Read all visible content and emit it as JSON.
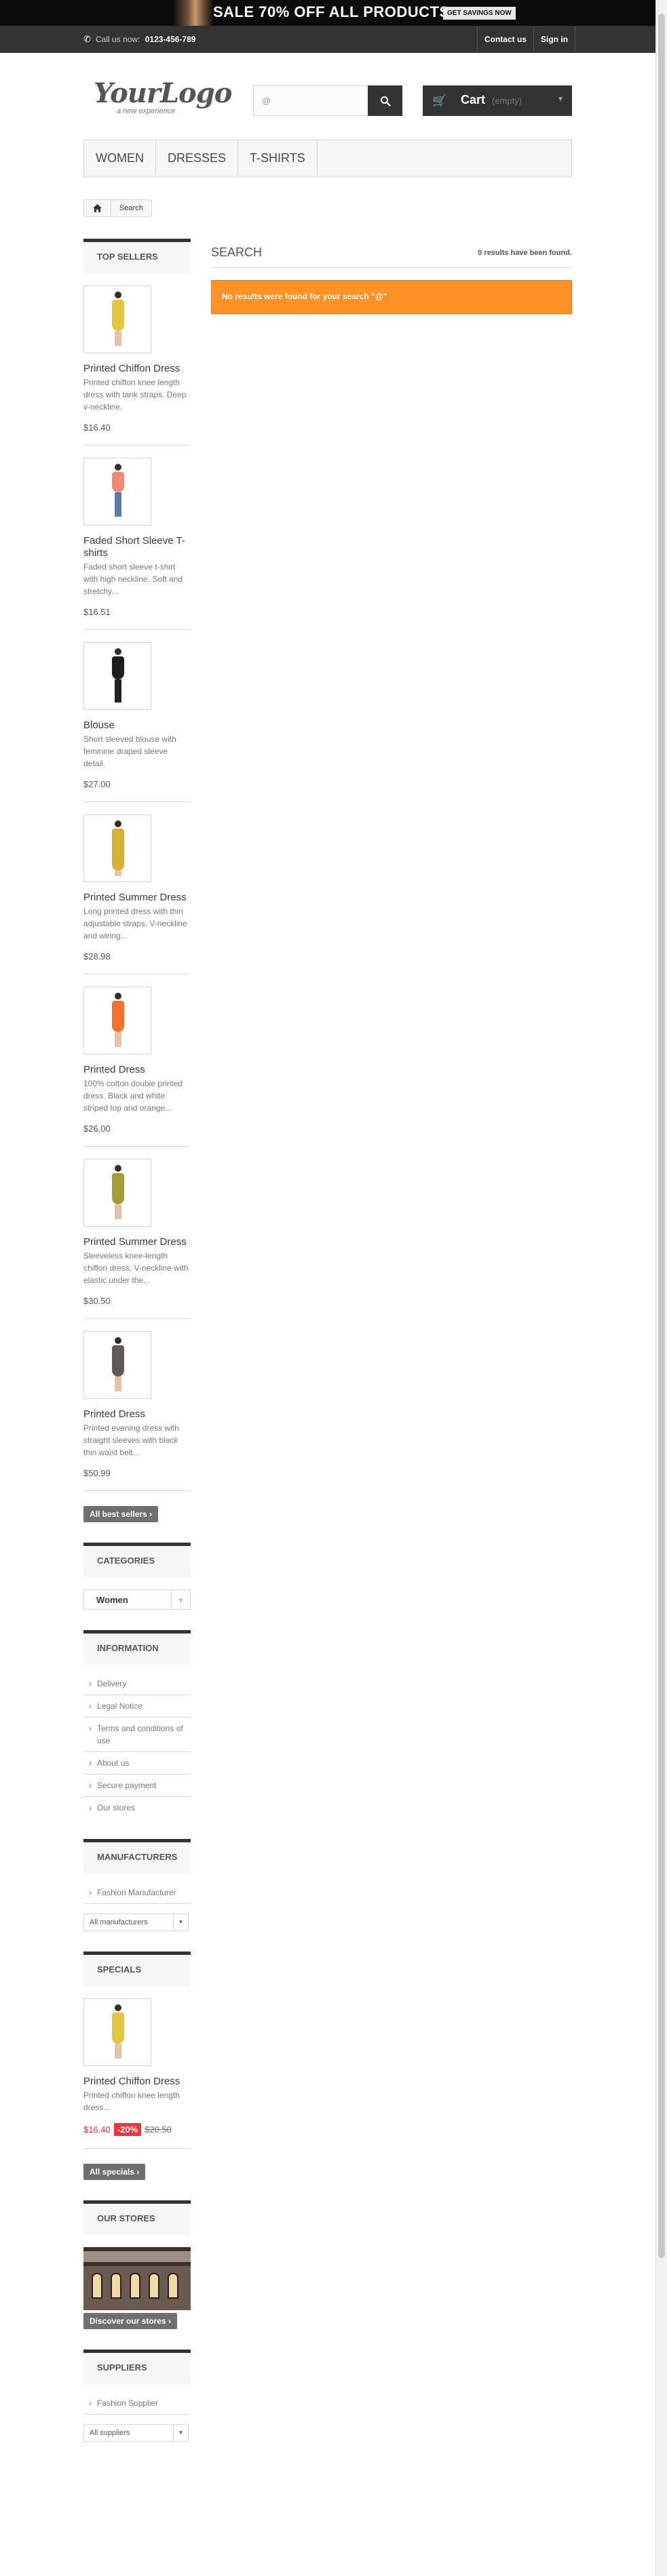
{
  "banner": {
    "text": "SALE 70% OFF ALL PRODUCTS",
    "cta": "GET SAVINGS NOW"
  },
  "nav": {
    "phone_label": "Call us now:",
    "phone_number": "0123-456-789",
    "contact": "Contact us",
    "signin": "Sign in"
  },
  "logo": {
    "main": "YourLogo",
    "tagline": "a new experience"
  },
  "search": {
    "value": "@"
  },
  "cart": {
    "label": "Cart",
    "status": "(empty)"
  },
  "menu": [
    "Women",
    "Dresses",
    "T-shirts"
  ],
  "breadcrumb": {
    "current": "Search"
  },
  "top_sellers": {
    "title": "Top sellers",
    "products": [
      {
        "name": "Printed Chiffon Dress",
        "desc": "Printed chiffon knee length dress with tank straps. Deep v-neckline.",
        "price": "$16.40"
      },
      {
        "name": "Faded Short Sleeve T-shirts",
        "desc": "Faded short sleeve t-shirt with high neckline. Soft and stretchy...",
        "price": "$16.51"
      },
      {
        "name": "Blouse",
        "desc": "Short sleeved blouse with feminine draped sleeve detail.",
        "price": "$27.00"
      },
      {
        "name": "Printed Summer Dress",
        "desc": "Long printed dress with thin adjustable straps. V-neckline and wiring...",
        "price": "$28.98"
      },
      {
        "name": "Printed Dress",
        "desc": "100% cotton double printed dress. Black and white striped top and orange...",
        "price": "$26.00"
      },
      {
        "name": "Printed Summer Dress",
        "desc": "Sleeveless knee-length chiffon dress. V-neckline with elastic under the...",
        "price": "$30.50"
      },
      {
        "name": "Printed Dress",
        "desc": "Printed evening dress with straight sleeves with black thin waist belt...",
        "price": "$50.99"
      }
    ],
    "button": "All best sellers"
  },
  "categories": {
    "title": "Categories",
    "items": [
      "Women"
    ]
  },
  "information": {
    "title": "Information",
    "links": [
      "Delivery",
      "Legal Notice",
      "Terms and conditions of use",
      "About us",
      "Secure payment",
      "Our stores"
    ]
  },
  "manufacturers": {
    "title": "Manufacturers",
    "links": [
      "Fashion Manufacturer"
    ],
    "select": "All manufacturers"
  },
  "specials": {
    "title": "Specials",
    "product": {
      "name": "Printed Chiffon Dress",
      "desc": "Printed chiffon knee length dress...",
      "price": "$16.40",
      "discount": "-20%",
      "old_price": "$20.50"
    },
    "button": "All specials"
  },
  "stores": {
    "title": "Our stores",
    "button": "Discover our stores"
  },
  "suppliers": {
    "title": "Suppliers",
    "links": [
      "Fashion Supplier"
    ],
    "select": "All suppliers"
  },
  "center": {
    "heading": "Search",
    "count": "0 results have been found.",
    "alert": "No results were found for your search \"@\""
  }
}
